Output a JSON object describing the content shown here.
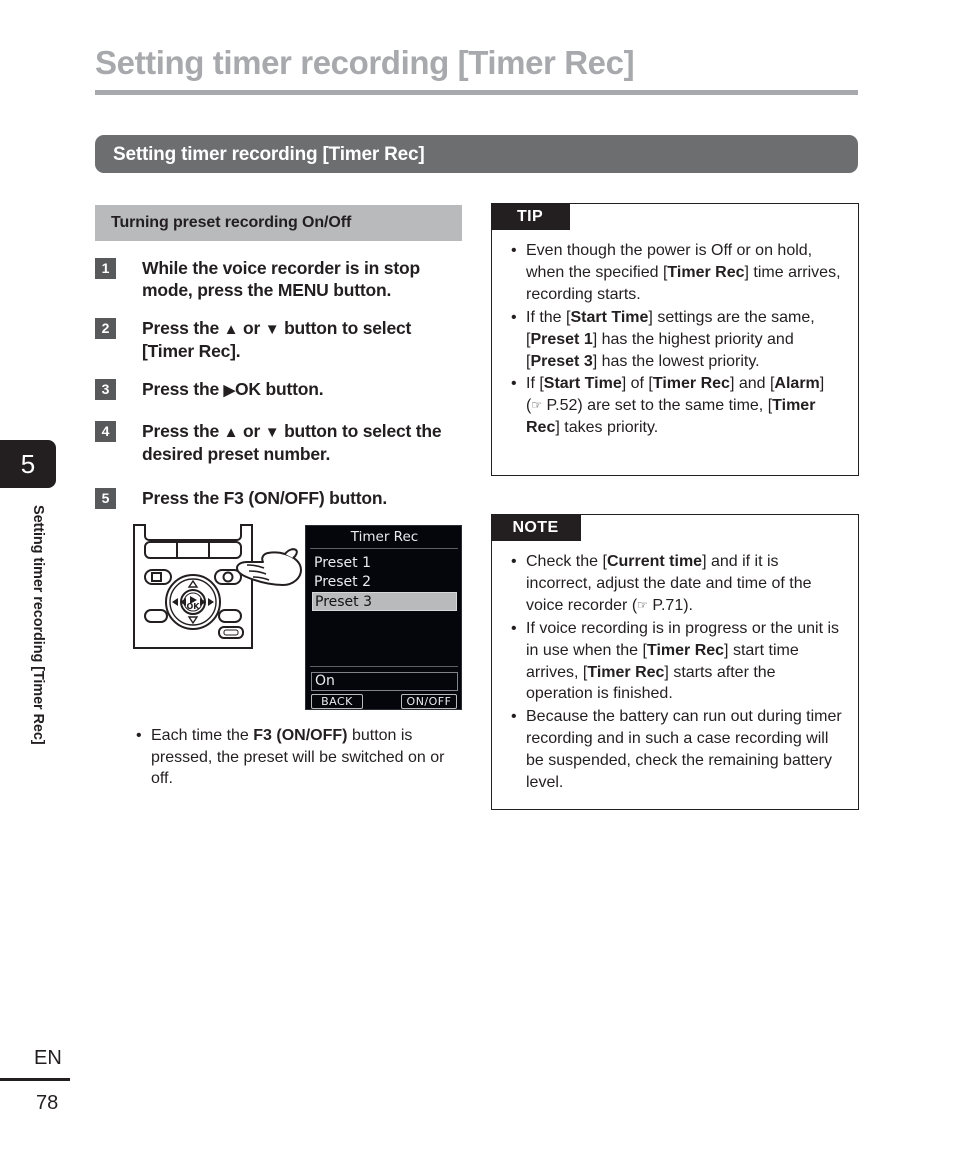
{
  "page": {
    "title": "Setting timer recording [Timer Rec]",
    "section_header": "Setting timer recording [Timer Rec]",
    "subsection_header": "Turning preset recording On/Off",
    "side_tab_number": "5",
    "side_tab_text": "Setting timer recording [Timer Rec]",
    "footer_language": "EN",
    "footer_page_number": "78",
    "colors": {
      "title_gray": "#a7a9ac",
      "section_bar_gray": "#6d6e70",
      "subsection_bar_gray": "#b9babc",
      "step_badge_gray": "#58595b",
      "callout_black": "#231f20",
      "lcd_background": "#05060b",
      "lcd_highlight": "#b9babc"
    }
  },
  "steps": [
    {
      "num": "1",
      "text": "While the voice recorder is in stop mode, press the MENU button."
    },
    {
      "num": "2",
      "text": "Press the ▲ or ▼ button to select [Timer Rec]."
    },
    {
      "num": "3",
      "text": "Press the ▶OK button."
    },
    {
      "num": "4",
      "text": "Press the ▲ or ▼ button to select the desired preset number."
    },
    {
      "num": "5",
      "text": "Press the F3 (ON/OFF) button."
    }
  ],
  "illustration": {
    "device_label": "voice-recorder-illustration",
    "hand_label": "pointing-hand-icon",
    "lcd": {
      "title": "Timer Rec",
      "items": [
        "Preset 1",
        "Preset 2",
        "Preset 3"
      ],
      "selected_item": "Preset 3",
      "status": "On",
      "softkey_left": "BACK",
      "softkey_right": "ON/OFF"
    },
    "note_bullet": "Each time the F3 (ON/OFF) button is pressed, the preset will be switched on or off."
  },
  "tip": {
    "label": "TIP",
    "bullets": [
      "Even though the power is Off or on hold, when the specified [Timer Rec] time arrives, recording starts.",
      "If the [Start Time] settings are the same, [Preset 1] has the highest priority and [Preset 3] has the lowest priority.",
      "If [Start Time] of [Timer Rec] and [Alarm] (☞ P.52) are set to the same time, [Timer Rec] takes priority."
    ]
  },
  "note": {
    "label": "NOTE",
    "bullets": [
      "Check the [Current time] and if it is incorrect, adjust the date and time of the voice recorder (☞ P.71).",
      "If voice recording is in progress or the unit is in use when the [Timer Rec] start time arrives, [Timer Rec] starts after the operation is finished.",
      "Because the battery can run out during timer recording and in such a case recording will be suspended, check the remaining battery level."
    ]
  }
}
